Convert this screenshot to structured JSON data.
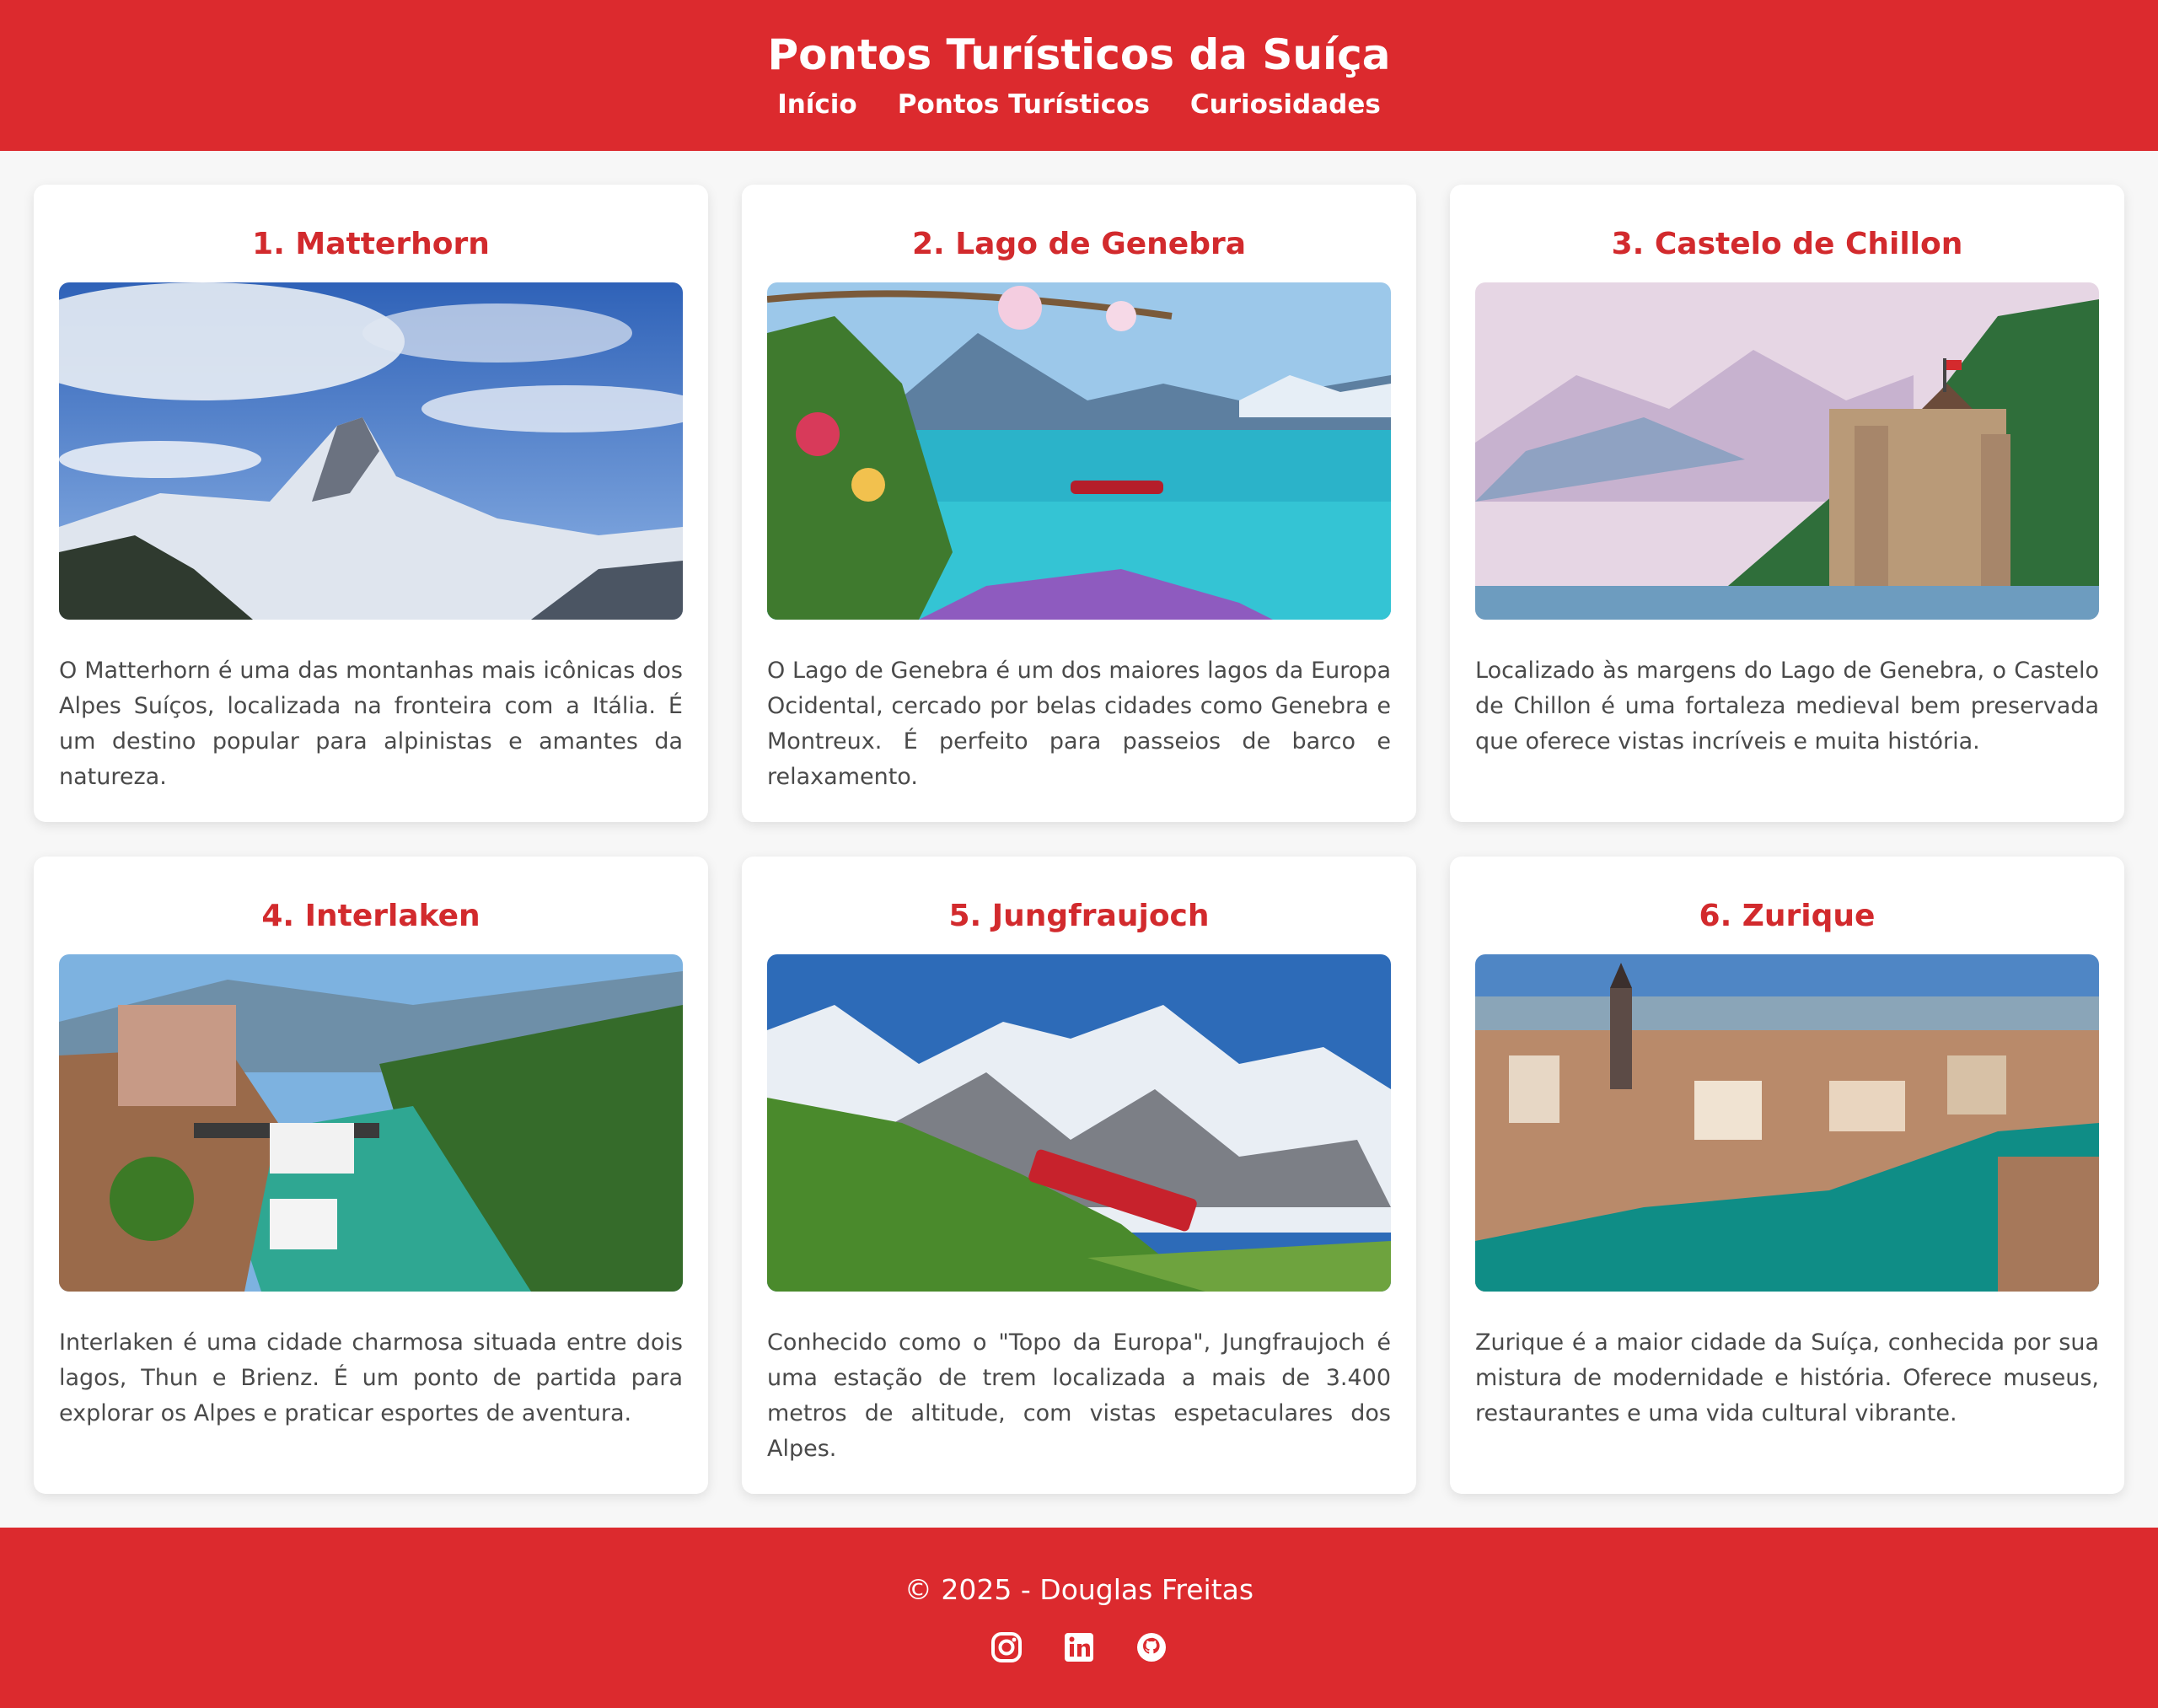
{
  "header": {
    "title": "Pontos Turísticos da Suíça",
    "nav": [
      "Início",
      "Pontos Turísticos",
      "Curiosidades"
    ]
  },
  "cards": [
    {
      "title": "1. Matterhorn",
      "image": "matterhorn-mountain-photo",
      "text": "O Matterhorn é uma das montanhas mais icônicas dos Alpes Suíços, localizada na fronteira com a Itália. É um destino popular para alpinistas e amantes da natureza."
    },
    {
      "title": "2. Lago de Genebra",
      "image": "lake-geneva-photo",
      "text": "O Lago de Genebra é um dos maiores lagos da Europa Ocidental, cercado por belas cidades como Genebra e Montreux. É perfeito para passeios de barco e relaxamento."
    },
    {
      "title": "3. Castelo de Chillon",
      "image": "chillon-castle-photo",
      "text": "Localizado às margens do Lago de Genebra, o Castelo de Chillon é uma fortaleza medieval bem preservada que oferece vistas incríveis e muita história."
    },
    {
      "title": "4. Interlaken",
      "image": "interlaken-river-photo",
      "text": "Interlaken é uma cidade charmosa situada entre dois lagos, Thun e Brienz. É um ponto de partida para explorar os Alpes e praticar esportes de aventura."
    },
    {
      "title": "5. Jungfraujoch",
      "image": "jungfraujoch-train-photo",
      "text": "Conhecido como o \"Topo da Europa\", Jungfraujoch é uma estação de trem localizada a mais de 3.400 metros de altitude, com vistas espetaculares dos Alpes."
    },
    {
      "title": "6. Zurique",
      "image": "zurich-city-photo",
      "text": "Zurique é a maior cidade da Suíça, conhecida por sua mistura de modernidade e história. Oferece museus, restaurantes e uma vida cultural vibrante."
    }
  ],
  "footer": {
    "copyright": "© 2025 - Douglas Freitas",
    "social": [
      "instagram-icon",
      "linkedin-icon",
      "github-icon"
    ]
  },
  "colors": {
    "brand_red": "#dc2a2e",
    "title_red": "#d22a2d",
    "background": "#f7f7f7"
  }
}
